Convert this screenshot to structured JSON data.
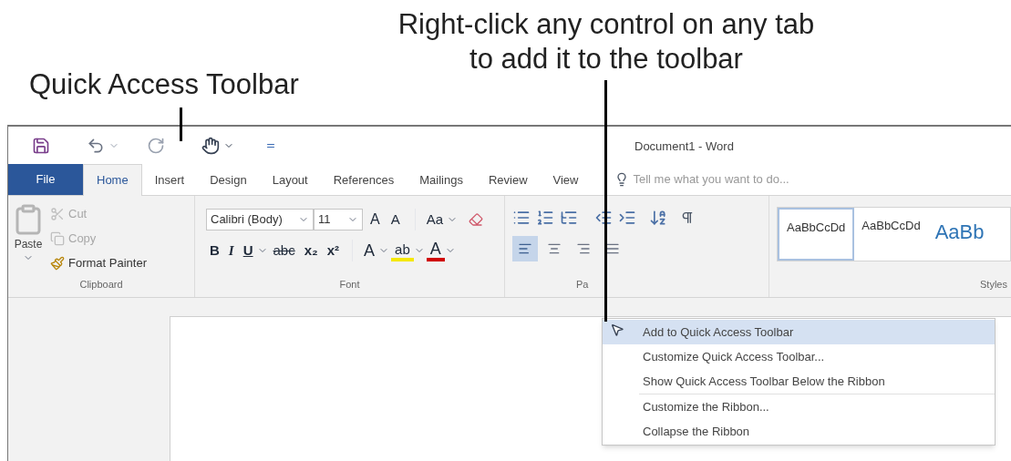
{
  "callouts": [
    {
      "text": "Quick Access Toolbar"
    },
    {
      "text": "Right-click any control on any tab to add it to the toolbar"
    }
  ],
  "window": {
    "title": "Document1 - Word"
  },
  "tabs": [
    {
      "label": "File",
      "kind": "file",
      "selected": false
    },
    {
      "label": "Home",
      "kind": "tab",
      "selected": true
    },
    {
      "label": "Insert",
      "kind": "tab",
      "selected": false
    },
    {
      "label": "Design",
      "kind": "tab",
      "selected": false
    },
    {
      "label": "Layout",
      "kind": "tab",
      "selected": false
    },
    {
      "label": "References",
      "kind": "tab",
      "selected": false
    },
    {
      "label": "Mailings",
      "kind": "tab",
      "selected": false
    },
    {
      "label": "Review",
      "kind": "tab",
      "selected": false
    },
    {
      "label": "View",
      "kind": "tab",
      "selected": false
    }
  ],
  "search": {
    "placeholder": "Tell me what you want to do..."
  },
  "clipboard": {
    "label": "Clipboard",
    "paste": "Paste",
    "items": [
      {
        "label": "Cut",
        "kind": "cut",
        "disabled": true
      },
      {
        "label": "Copy",
        "kind": "copy",
        "disabled": true
      },
      {
        "label": "Format Painter",
        "kind": "painter",
        "disabled": false
      }
    ]
  },
  "font": {
    "label": "Font",
    "name": "Calibri (Body)",
    "size": "11",
    "row1": [
      {
        "text": "A",
        "kind": "grow"
      },
      {
        "text": "A",
        "kind": "shrink"
      },
      {
        "text": "Aa",
        "kind": "case"
      }
    ],
    "row2": [
      {
        "text": "B",
        "kind": "bold"
      },
      {
        "text": "I",
        "kind": "italic"
      },
      {
        "text": "U",
        "kind": "underline"
      },
      {
        "text": "abc",
        "kind": "strike"
      },
      {
        "text": "x₂",
        "kind": "sub"
      },
      {
        "text": "x²",
        "kind": "sup"
      },
      {
        "text": "A",
        "kind": "effects"
      },
      {
        "text": "ab",
        "kind": "highlight"
      },
      {
        "text": "A",
        "kind": "color"
      }
    ]
  },
  "paragraph": {
    "label": "Pa",
    "align": [
      {
        "kind": "left",
        "selected": true
      },
      {
        "kind": "center",
        "selected": false
      },
      {
        "kind": "right",
        "selected": false
      },
      {
        "kind": "justify",
        "selected": false
      }
    ]
  },
  "styles": {
    "label": "Styles",
    "items": [
      {
        "sample": "AaBbCcDd",
        "kind": "normal",
        "selected": true
      },
      {
        "sample": "AaBbCcDd",
        "kind": "normal",
        "selected": false
      },
      {
        "sample": "AaBb",
        "kind": "heading",
        "selected": false
      }
    ]
  },
  "context_menu": {
    "items": [
      {
        "label": "Add to Quick Access Toolbar",
        "selected": true,
        "separator_before": false
      },
      {
        "label": "Customize Quick Access Toolbar...",
        "selected": false,
        "separator_before": false
      },
      {
        "label": "Show Quick Access Toolbar Below the Ribbon",
        "selected": false,
        "separator_before": false
      },
      {
        "label": "Customize the Ribbon...",
        "selected": false,
        "separator_before": true
      },
      {
        "label": "Collapse the Ribbon",
        "selected": false,
        "separator_before": false
      }
    ]
  }
}
